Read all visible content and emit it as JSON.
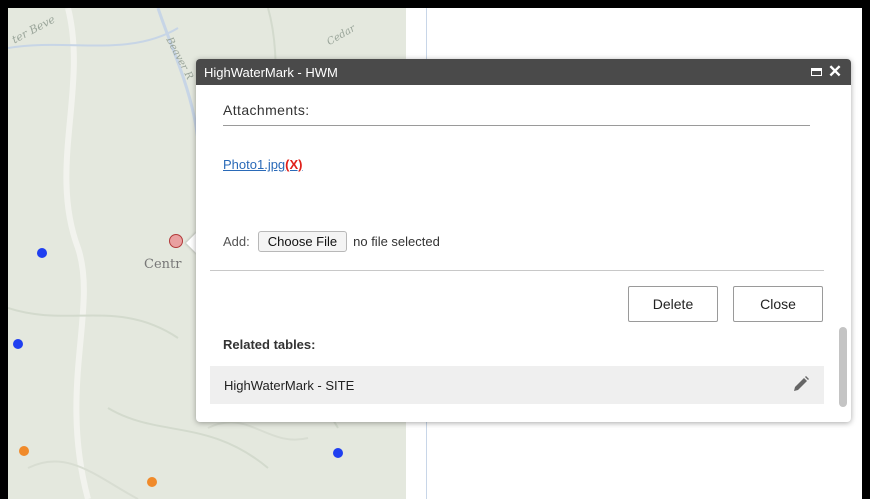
{
  "map": {
    "town_label": "Centr",
    "river_labels": [
      "ter Beve",
      "Beaver R",
      "Cedar"
    ]
  },
  "popup": {
    "title": "HighWaterMark - HWM",
    "attachments_heading": "Attachments:",
    "attachment_file": "Photo1.jpg",
    "attachment_remove": "(X)",
    "add_label": "Add:",
    "choose_file_label": "Choose File",
    "no_file_text": "no file selected",
    "delete_label": "Delete",
    "close_label": "Close",
    "related_tables_heading": "Related tables:",
    "related_tables": [
      {
        "name": "HighWaterMark - SITE",
        "icon": "pencil-icon"
      }
    ]
  },
  "colors": {
    "header_bg": "#4a4a4a",
    "link": "#2a6ab8",
    "remove_x": "#e0201a",
    "point_blue": "#1f3ff0",
    "point_orange": "#f08a2a",
    "selected_point": "#e9a0a0"
  }
}
